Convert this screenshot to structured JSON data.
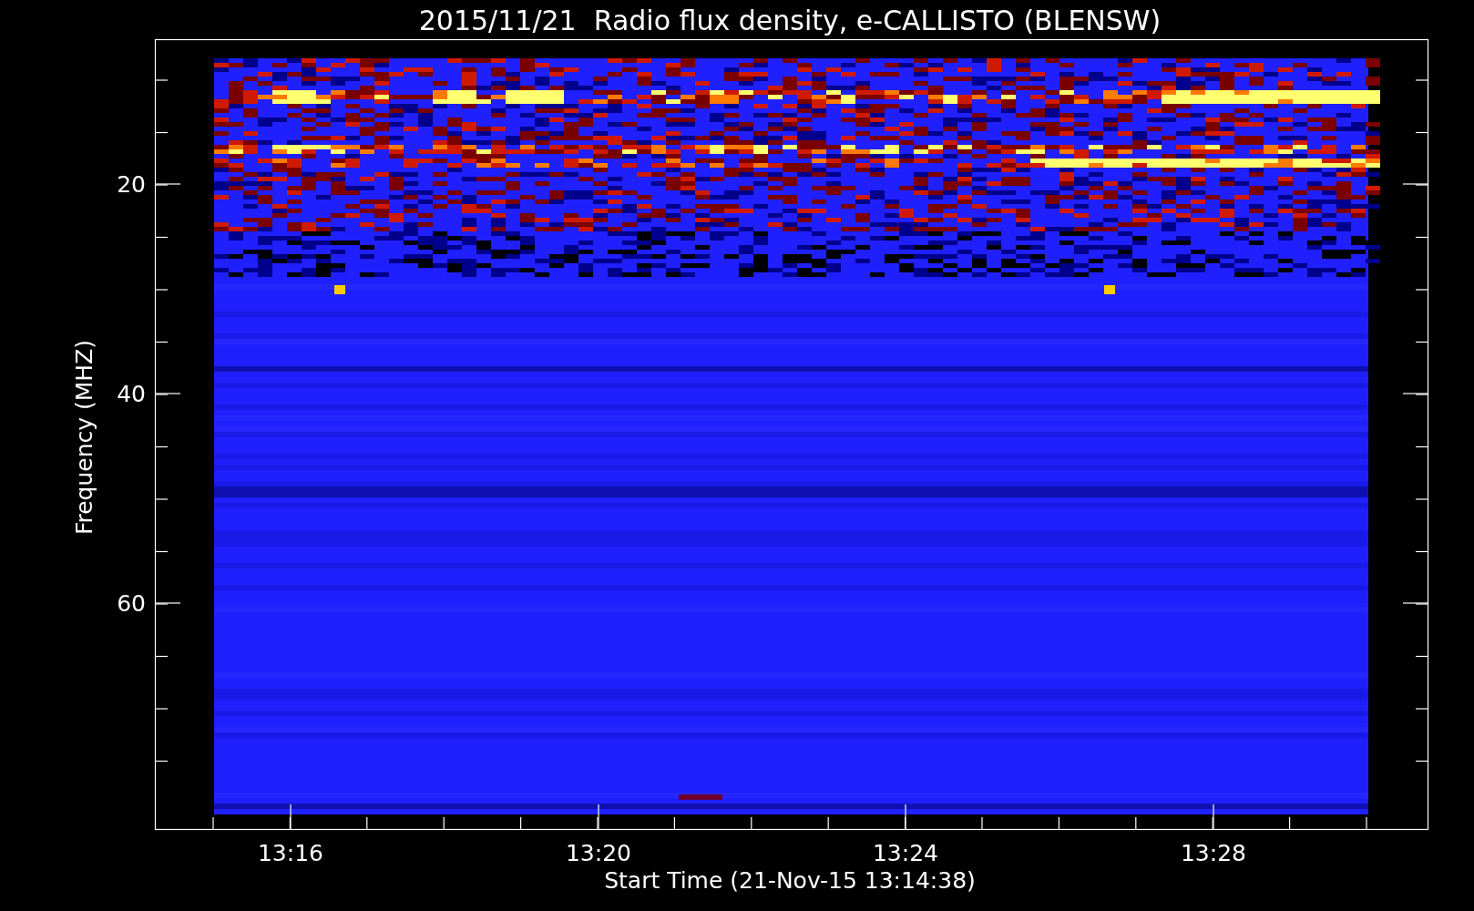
{
  "title": "2015/11/21  Radio flux density, e-CALLISTO (BLENSW)",
  "y_axis": {
    "label": "Frequency (MHZ)",
    "ticks": [
      "20",
      "40",
      "60"
    ]
  },
  "x_axis": {
    "label": "Start Time (21-Nov-15 13:14:38)",
    "ticks": [
      "13:16",
      "13:20",
      "13:24",
      "13:28"
    ]
  }
}
